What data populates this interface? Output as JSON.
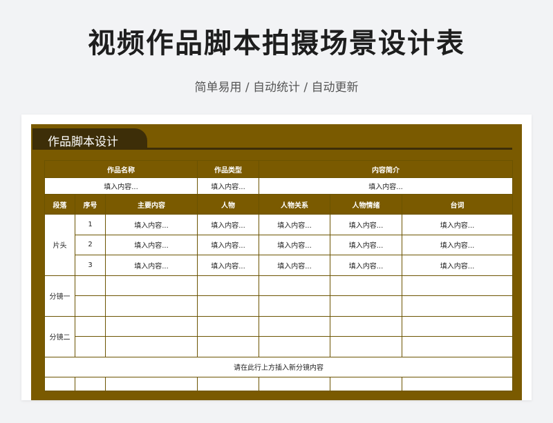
{
  "title": "视频作品脚本拍摄场景设计表",
  "subtitle": "简单易用 / 自动统计 / 自动更新",
  "sheet": {
    "tab_label": "作品脚本设计",
    "info_headers": [
      "作品名称",
      "作品类型",
      "内容简介"
    ],
    "info_values": [
      "填入内容...",
      "填入内容...",
      "填入内容..."
    ],
    "columns": [
      "段落",
      "序号",
      "主要内容",
      "人物",
      "人物关系",
      "人物情绪",
      "台词"
    ],
    "segments": [
      "片头",
      "分镜一",
      "分镜二"
    ],
    "row_numbers": [
      "1",
      "2",
      "3"
    ],
    "placeholder": "填入内容...",
    "insert_note": "请在此行上方插入新分镜内容"
  },
  "colors": {
    "frame": "#7a5a00",
    "tab": "#3d2e08",
    "header_text": "#ffffff"
  }
}
